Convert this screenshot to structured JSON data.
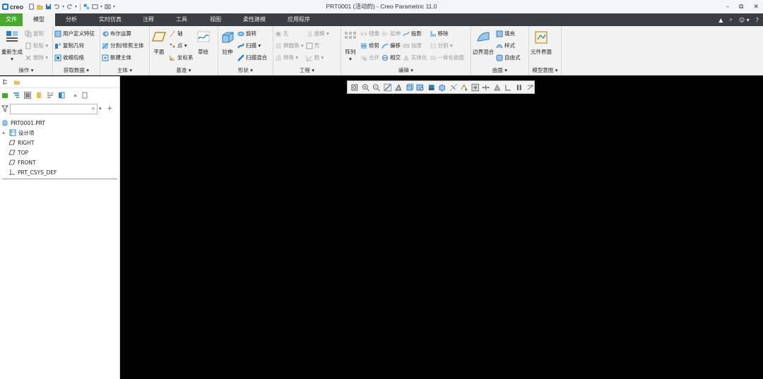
{
  "app": {
    "logo_text": "creo",
    "title": "PRT0001 (活动的) - Creo Parametric 11.0"
  },
  "window_controls": [
    "–",
    "⧉",
    "✕"
  ],
  "tabs": [
    {
      "label": "文件",
      "state": "file"
    },
    {
      "label": "模型",
      "state": "active"
    },
    {
      "label": "分析",
      "state": "normal"
    },
    {
      "label": "实时仿真",
      "state": "normal"
    },
    {
      "label": "注释",
      "state": "normal"
    },
    {
      "label": "工具",
      "state": "normal"
    },
    {
      "label": "视图",
      "state": "normal"
    },
    {
      "label": "柔性建模",
      "state": "normal"
    },
    {
      "label": "应用程序",
      "state": "normal"
    }
  ],
  "tabbar_right": [
    "▲",
    "⌕",
    "☺ ▾",
    "?"
  ],
  "ribbon": {
    "operations": {
      "label": "操作 ▾",
      "regenerate": "重新生成",
      "copy": "复制",
      "paste": "粘贴 ▾",
      "delete": "删除 ▾"
    },
    "get_data": {
      "label": "获取数据 ▾",
      "udf": "用户定义特征",
      "copy_geometry": "复制几何",
      "shrinkwrap": "收缩包络"
    },
    "body": {
      "label": "主体 ▾",
      "boolean": "布尔运算",
      "split_trim": "分割/修剪主体",
      "new_body": "新建主体"
    },
    "datum": {
      "label": "基准 ▾",
      "plane": "平面",
      "axis": "轴",
      "point": "点 ▾",
      "csys": "坐标系",
      "sketch": "草绘"
    },
    "shapes": {
      "label": "形状 ▾",
      "extrude": "拉伸",
      "revolve": "旋转",
      "sweep": "扫描 ▾",
      "swept_blend": "扫描混合"
    },
    "engineering": {
      "label": "工程 ▾",
      "hole": "孔",
      "round": "倒圆角 ▾",
      "chamfer": "倒角 ▾",
      "draft": "拔模 ▾",
      "shell": "壳",
      "rib": "筋 ▾"
    },
    "editing": {
      "label": "编辑 ▾",
      "pattern": "阵列",
      "mirror": "镜像",
      "trim": "修剪",
      "merge": "合并",
      "extend": "延伸",
      "offset": "偏移",
      "intersect": "相交",
      "project": "投影",
      "thicken": "加厚",
      "solidify": "实体化",
      "remove": "移除",
      "split": "分割 ▾",
      "unify_surfaces": "一体化曲面"
    },
    "surfaces": {
      "label": "曲面 ▾",
      "boundary_blend": "边界混合",
      "fill": "填充",
      "style": "样式",
      "freestyle": "自由式"
    },
    "model_intent": {
      "label": "模型意图 ▾",
      "component_interface": "元件界面"
    }
  },
  "model_tree": {
    "search_placeholder": "",
    "clear": "×",
    "root": "PRT0001.PRT",
    "items": [
      {
        "label": "设计项",
        "icon": "design-items-icon",
        "expandable": true
      },
      {
        "label": "RIGHT",
        "icon": "datum-plane-icon",
        "expandable": false
      },
      {
        "label": "TOP",
        "icon": "datum-plane-icon",
        "expandable": false
      },
      {
        "label": "FRONT",
        "icon": "datum-plane-icon",
        "expandable": false
      },
      {
        "label": "PRT_CSYS_DEF",
        "icon": "csys-icon",
        "expandable": false
      }
    ]
  },
  "colors": {
    "accent_green": "#4aa832",
    "tabbar_bg": "#3a3d41",
    "ribbon_bg": "#f2f2f2",
    "graphics_bg": "#000000",
    "icon_blue": "#1f7ab5"
  },
  "graphics_toolbar_icons": [
    "refit-icon",
    "zoom-in-icon",
    "zoom-out-icon",
    "repaint-icon",
    "perspective-icon",
    "saved-orientations-icon",
    "named-views-icon",
    "display-style-icon",
    "section-icon",
    "datum-display-icon",
    "annotation-display-icon",
    "spin-center-icon",
    "axis-display-icon",
    "point-display-icon",
    "csys-display-icon",
    "pause-icon",
    "rotate-icon"
  ]
}
